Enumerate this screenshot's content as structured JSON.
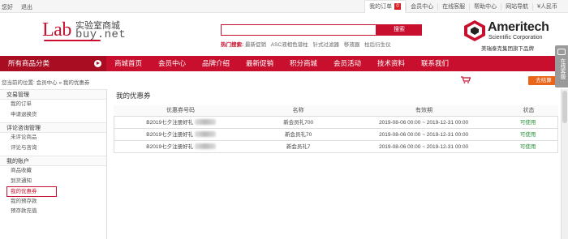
{
  "topbar": {
    "user": "您好",
    "logout": "退出",
    "links": [
      {
        "label": "我的订单",
        "badge": "0",
        "active": true
      },
      {
        "label": "会员中心"
      },
      {
        "label": "在线客服"
      },
      {
        "label": "帮助中心"
      },
      {
        "label": "网站导航"
      },
      {
        "label": "¥人民币"
      }
    ]
  },
  "logo": {
    "lab": "Lab",
    "cn": "实验室商城",
    "buy": "buy.net"
  },
  "search": {
    "placeholder": "",
    "button": "搜索"
  },
  "hot": {
    "label": "热门搜索:",
    "keywords": [
      "最新促销",
      "ASC液相色谱柱",
      "针式过滤器",
      "移液器",
      "柱后衍生仪"
    ]
  },
  "brand": {
    "name": "Ameritech",
    "sub": "Scientific Corporation",
    "tag": "美瑞泰克集团旗下品牌"
  },
  "nav": {
    "category": "所有商品分类",
    "items": [
      "商城首页",
      "会员中心",
      "品牌介绍",
      "最新促销",
      "积分商城",
      "会员活动",
      "技术资料",
      "联系我们"
    ]
  },
  "breadcrumb": "您当前的位置: 会员中心 » 我的优惠券",
  "checkout": "去结算",
  "sidebar": {
    "groups": [
      {
        "title": "交易管理",
        "items": [
          "我的订单",
          "申请退换货"
        ]
      },
      {
        "title": "评论咨询管理",
        "items": [
          "未评论商品",
          "评论与咨询"
        ]
      },
      {
        "title": "我的账户",
        "items": [
          "商品收藏",
          "到货通知",
          "我的优惠券",
          "我的预存款",
          "预存款充值"
        ]
      }
    ],
    "selected": "我的优惠券"
  },
  "main": {
    "title": "我的优惠券",
    "columns": [
      "优惠券号码",
      "名称",
      "有效期",
      "状态"
    ],
    "rows": [
      {
        "code": "B2019七夕注册好礼",
        "name": "新会员礼700",
        "period": "2019-08-06 00:00 ~ 2019-12-31 00:00",
        "status": "可使用"
      },
      {
        "code": "B2019七夕注册好礼",
        "name": "新会员礼70",
        "period": "2019-08-06 00:00 ~ 2019-12-31 00:00",
        "status": "可使用"
      },
      {
        "code": "B2019七夕注册好礼",
        "name": "新会员礼7",
        "period": "2019-08-06 00:00 ~ 2019-12-31 00:00",
        "status": "可使用"
      }
    ]
  },
  "float": {
    "label": "在线客服"
  },
  "colors": {
    "primary": "#c8102e",
    "nav_dark": "#a80d22",
    "checkout": "#e8651a",
    "status_ok": "#2a8f3a"
  }
}
